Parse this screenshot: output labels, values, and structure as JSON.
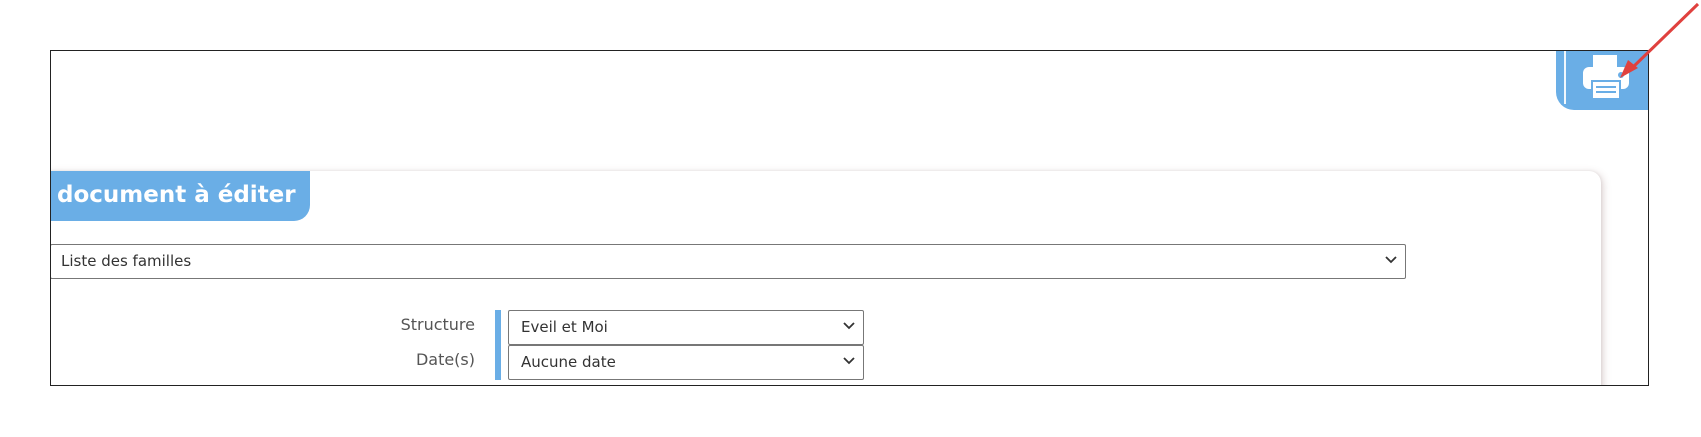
{
  "print_tab": {
    "icon": "printer-icon"
  },
  "card": {
    "title": "document à éditer"
  },
  "document_select": {
    "value": "Liste des familles"
  },
  "filters": {
    "structure": {
      "label": "Structure",
      "value": "Eveil et Moi"
    },
    "dates": {
      "label": "Date(s)",
      "value": "Aucune date"
    }
  },
  "colors": {
    "accent": "#6aaee6",
    "arrow": "#e0413e"
  }
}
